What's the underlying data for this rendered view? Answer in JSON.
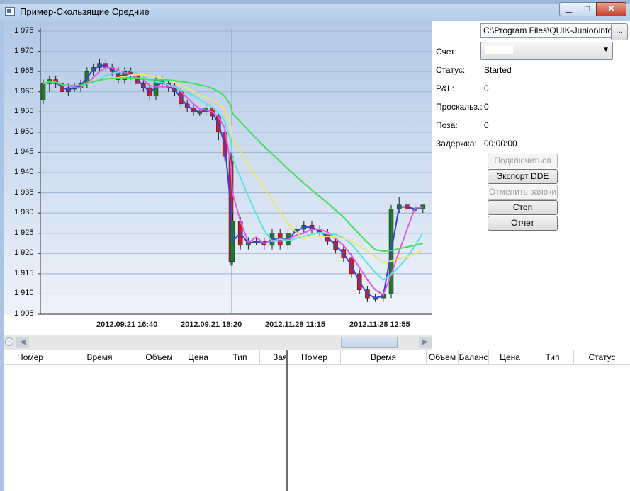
{
  "window": {
    "title": "Пример-Скользящие Средние",
    "controls": {
      "minimize": "▁",
      "maximize": "□",
      "close": "✕"
    }
  },
  "settings": {
    "path_value": "C:\\Program Files\\QUIK-Junior\\info",
    "browse_label": "...",
    "account_label": "Счет:",
    "status_label": "Статус:",
    "status_value": "Started",
    "pnl_label": "P&L:",
    "pnl_value": "0",
    "slippage_label": "Проскальз.:",
    "slippage_value": "0",
    "position_label": "Поза:",
    "position_value": "0",
    "latency_label": "Задержка:",
    "latency_value": "00:00:00"
  },
  "buttons": {
    "connect": "Подключиться",
    "export_dde": "Экспорт DDE",
    "cancel_orders": "Отменить заявки",
    "stop": "Стоп",
    "report": "Отчет"
  },
  "chart": {
    "y_ticks": [
      "1 975",
      "1 970",
      "1 965",
      "1 960",
      "1 955",
      "1 950",
      "1 945",
      "1 940",
      "1 935",
      "1 930",
      "1 925",
      "1 920",
      "1 915",
      "1 910",
      "1 905"
    ],
    "x_ticks": [
      "2012.09.21 16:40",
      "2012.09.21 18:20",
      "2012.11.28 11:15",
      "2012.11.28 12:55"
    ],
    "colors": {
      "bull": "#1f7a2e",
      "bear": "#cc1f2a",
      "ma_green": "#3ee05c",
      "ma_yellow": "#e9e676",
      "ma_cyan": "#59e3e3",
      "ma_magenta": "#e25ae2",
      "ma_blue": "#3c3fd6"
    }
  },
  "chart_data": {
    "type": "candlestick",
    "title": "",
    "ylim": [
      1905,
      1975
    ],
    "candles": [
      [
        1958,
        1963,
        1957,
        1962
      ],
      [
        1962,
        1964,
        1960,
        1963
      ],
      [
        1963,
        1964,
        1961,
        1962
      ],
      [
        1962,
        1963,
        1959,
        1960
      ],
      [
        1960,
        1962,
        1959,
        1961
      ],
      [
        1961,
        1962,
        1960,
        1961
      ],
      [
        1961,
        1963,
        1960,
        1962
      ],
      [
        1962,
        1966,
        1961,
        1965
      ],
      [
        1965,
        1967,
        1964,
        1966
      ],
      [
        1966,
        1968,
        1965,
        1967
      ],
      [
        1967,
        1968,
        1965,
        1966
      ],
      [
        1966,
        1967,
        1964,
        1965
      ],
      [
        1965,
        1966,
        1962,
        1963
      ],
      [
        1963,
        1966,
        1962,
        1965
      ],
      [
        1965,
        1966,
        1963,
        1964
      ],
      [
        1964,
        1965,
        1961,
        1962
      ],
      [
        1962,
        1963,
        1960,
        1961
      ],
      [
        1961,
        1962,
        1958,
        1959
      ],
      [
        1959,
        1964,
        1958,
        1963
      ],
      [
        1963,
        1964,
        1961,
        1962
      ],
      [
        1962,
        1963,
        1960,
        1961
      ],
      [
        1961,
        1962,
        1959,
        1960
      ],
      [
        1960,
        1961,
        1956,
        1957
      ],
      [
        1957,
        1958,
        1955,
        1956
      ],
      [
        1956,
        1957,
        1954,
        1955
      ],
      [
        1955,
        1956,
        1954,
        1955
      ],
      [
        1955,
        1957,
        1954,
        1956
      ],
      [
        1956,
        1956,
        1953,
        1954
      ],
      [
        1954,
        1955,
        1948,
        1950
      ],
      [
        1950,
        1951,
        1943,
        1944
      ],
      [
        1944,
        1945,
        1917,
        1918
      ],
      [
        1918,
        1930,
        1917,
        1928
      ],
      [
        1928,
        1929,
        1921,
        1922
      ],
      [
        1922,
        1924,
        1921,
        1923
      ],
      [
        1923,
        1924,
        1922,
        1923
      ],
      [
        1923,
        1924,
        1921,
        1922
      ],
      [
        1922,
        1926,
        1921,
        1925
      ],
      [
        1925,
        1926,
        1921,
        1922
      ],
      [
        1922,
        1926,
        1921,
        1925
      ],
      [
        1925,
        1927,
        1924,
        1926
      ],
      [
        1926,
        1928,
        1925,
        1927
      ],
      [
        1927,
        1928,
        1925,
        1926
      ],
      [
        1926,
        1927,
        1924,
        1925
      ],
      [
        1925,
        1926,
        1922,
        1923
      ],
      [
        1923,
        1924,
        1920,
        1921
      ],
      [
        1921,
        1922,
        1918,
        1919
      ],
      [
        1919,
        1920,
        1914,
        1915
      ],
      [
        1915,
        1916,
        1910,
        1911
      ],
      [
        1911,
        1912,
        1908,
        1909
      ],
      [
        1909,
        1910,
        1908,
        1909
      ],
      [
        1909,
        1911,
        1908,
        1910
      ],
      [
        1910,
        1932,
        1909,
        1931
      ],
      [
        1931,
        1934,
        1930,
        1932
      ],
      [
        1932,
        1933,
        1930,
        1931
      ],
      [
        1931,
        1932,
        1930,
        1931
      ],
      [
        1931,
        1932,
        1930,
        1932
      ]
    ],
    "candle_format": [
      "open",
      "high",
      "low",
      "close"
    ]
  },
  "orders_grid": {
    "columns": [
      "Номер",
      "Время",
      "Объем",
      "Цена",
      "Тип",
      "Зая"
    ]
  },
  "trades_grid": {
    "columns": [
      "Номер",
      "Время",
      "Объем",
      "Баланс",
      "Цена",
      "Тип",
      "Статус"
    ]
  }
}
